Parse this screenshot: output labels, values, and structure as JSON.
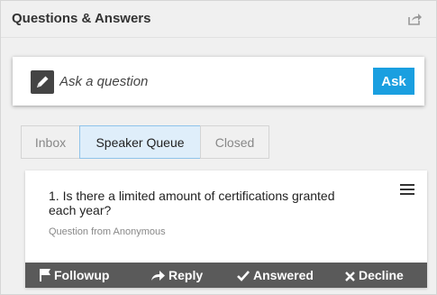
{
  "header": {
    "title": "Questions & Answers",
    "popout_icon": "share-arrow-icon"
  },
  "ask": {
    "placeholder": "Ask a question",
    "button_label": "Ask",
    "icon": "pencil-icon",
    "button_color": "#1a9fe0"
  },
  "tabs": [
    {
      "label": "Inbox",
      "active": false
    },
    {
      "label": "Speaker Queue",
      "active": true
    },
    {
      "label": "Closed",
      "active": false
    }
  ],
  "question": {
    "text": "1. Is there a limited amount of certifications granted each year?",
    "meta": "Question from Anonymous",
    "menu_icon": "hamburger-menu-icon"
  },
  "actions": [
    {
      "label": "Followup",
      "icon": "flag-icon"
    },
    {
      "label": "Reply",
      "icon": "reply-arrow-icon"
    },
    {
      "label": "Answered",
      "icon": "check-icon"
    },
    {
      "label": "Decline",
      "icon": "x-icon"
    }
  ]
}
